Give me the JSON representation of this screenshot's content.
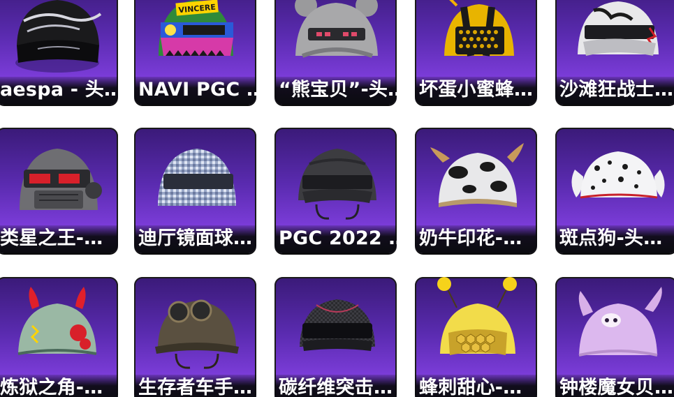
{
  "items": [
    {
      "label": "aespa - 头…",
      "icon": "helmet-black-chrome-icon"
    },
    {
      "label": "NAVI PGC …",
      "icon": "helmet-navi-yellow-icon",
      "badge": "VINCERE"
    },
    {
      "label": "“熊宝贝”-头…",
      "icon": "helmet-bear-grey-icon"
    },
    {
      "label": "坏蛋小蜜蜂…",
      "icon": "helmet-bee-gold-icon"
    },
    {
      "label": "沙滩狂战士…",
      "icon": "helmet-white-red-icon"
    },
    {
      "label": "类星之王-…",
      "icon": "helmet-knight-red-visor-icon"
    },
    {
      "label": "迪厅镜面球…",
      "icon": "helmet-disco-ball-icon"
    },
    {
      "label": "PGC 2022 …",
      "icon": "helmet-pgc-dark-icon"
    },
    {
      "label": "奶牛印花-…",
      "icon": "helmet-cow-print-icon"
    },
    {
      "label": "斑点狗-头…",
      "icon": "helmet-dalmatian-icon"
    },
    {
      "label": "炼狱之角-…",
      "icon": "helmet-devil-horns-icon"
    },
    {
      "label": "生存者车手…",
      "icon": "helmet-goggles-driver-icon"
    },
    {
      "label": "碳纤维突击…",
      "icon": "helmet-carbon-assault-icon"
    },
    {
      "label": "蜂刺甜心-…",
      "icon": "helmet-bee-sweet-icon"
    },
    {
      "label": "钟楼魔女贝…",
      "icon": "helmet-witch-lavender-icon"
    }
  ],
  "colors": {
    "card_bg_top": "#3a1a78",
    "card_bg_mid": "#7b3cd8",
    "label_text": "#ffffff"
  }
}
